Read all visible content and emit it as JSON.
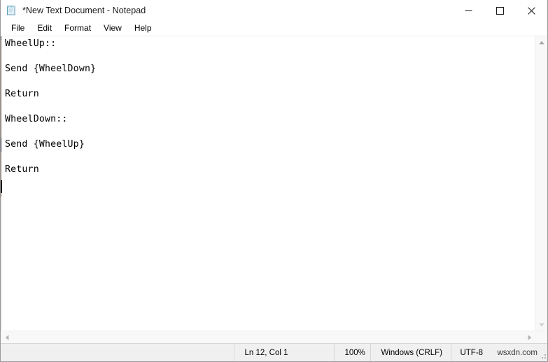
{
  "window": {
    "title": "*New Text Document - Notepad",
    "icon": "notepad-icon",
    "controls": {
      "minimize_label": "─",
      "maximize_label": "☐",
      "close_label": "✕"
    }
  },
  "menubar": {
    "items": [
      {
        "label": "File"
      },
      {
        "label": "Edit"
      },
      {
        "label": "Format"
      },
      {
        "label": "View"
      },
      {
        "label": "Help"
      }
    ]
  },
  "editor": {
    "lines": [
      "WheelUp::",
      "",
      "Send {WheelDown}",
      "",
      "Return",
      "",
      "WheelDown::",
      "",
      "Send {WheelUp}",
      "",
      "Return",
      ""
    ]
  },
  "scrollbars": {
    "vertical": {
      "up_arrow": "▲",
      "down_arrow": "▼"
    },
    "horizontal": {
      "left_arrow": "◀",
      "right_arrow": "▶"
    }
  },
  "statusbar": {
    "cursor_position": "Ln 12, Col 1",
    "zoom": "100%",
    "line_ending": "Windows (CRLF)",
    "encoding": "UTF-8"
  },
  "watermark": {
    "text": "wsxdn.com"
  },
  "colors": {
    "window_background": "#ffffff",
    "statusbar_background": "#f0f0f0",
    "text": "#000000",
    "scrollbar_background": "#f8f8f8",
    "close_hover": "#e81123"
  }
}
